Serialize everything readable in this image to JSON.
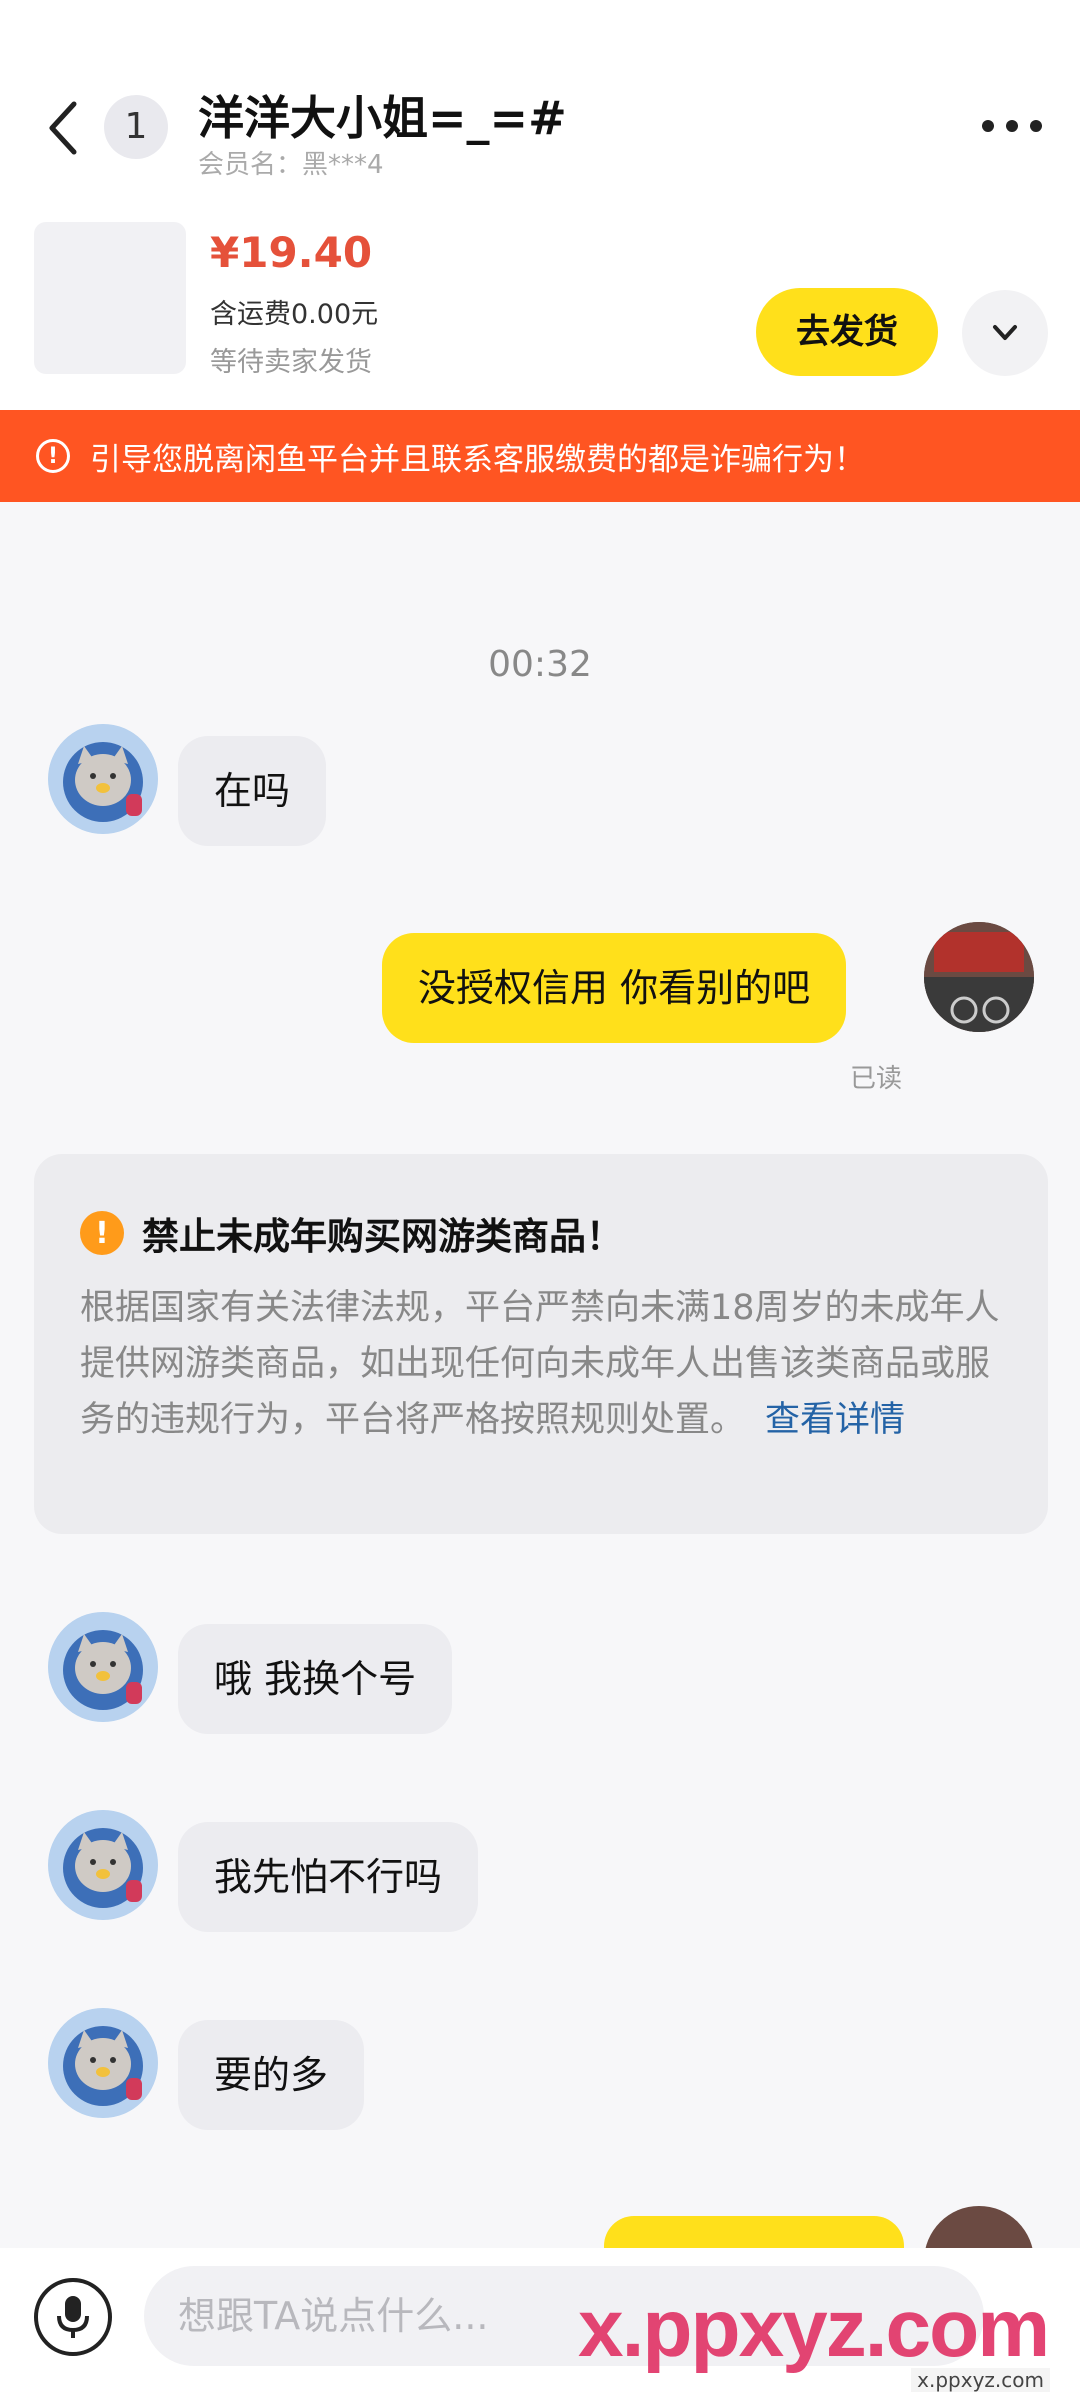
{
  "header": {
    "unread_count": "1",
    "title": "洋洋大小姐=_=#",
    "subtitle": "会员名：黑***4"
  },
  "order": {
    "price": "¥19.40",
    "shipping": "含运费0.00元",
    "status": "等待卖家发货",
    "ship_button": "去发货"
  },
  "warning_banner": {
    "text": "引导您脱离闲鱼平台并且联系客服缴费的都是诈骗行为！"
  },
  "chat": {
    "timestamp": "00:32",
    "messages": [
      {
        "from": "other",
        "text": "在吗"
      },
      {
        "from": "me",
        "text": "没授权信用 你看别的吧"
      },
      {
        "from": "other",
        "text": "哦 我换个号"
      },
      {
        "from": "other",
        "text": "我先怕不行吗"
      },
      {
        "from": "other",
        "text": "要的多"
      }
    ],
    "read_status": "已读"
  },
  "notice": {
    "title": "禁止未成年购买网游类商品！",
    "body": "根据国家有关法律法规，平台严禁向未满18周岁的未成年人提供网游类商品，如出现任何向未成年人出售该类商品或服务的违规行为，平台将严格按照规则处置。",
    "link": "查看详情"
  },
  "input": {
    "placeholder": "想跟TA说点什么..."
  },
  "watermark": {
    "main": "x.ppxyz.com",
    "sub": "x.ppxyz.com"
  },
  "colors": {
    "accent_yellow": "#ffe01b",
    "warning_orange": "#ff5522",
    "price_red": "#e5513a",
    "link_blue": "#2463a6"
  }
}
